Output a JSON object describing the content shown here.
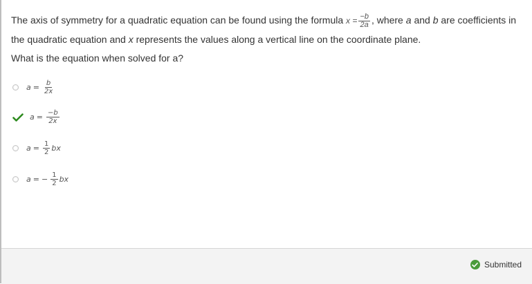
{
  "question": {
    "text_1": "The axis of symmetry for a quadratic equation can be found using the formula",
    "formula_lhs": "x =",
    "formula_num": "−b",
    "formula_den": "2a",
    "text_2": ", where",
    "var_a": "a",
    "text_3": "and",
    "var_b": "b",
    "text_4": "are coefficients in the quadratic equation and",
    "var_x": "x",
    "text_5": "represents the values along a vertical line on the coordinate plane.",
    "prompt": "What is the equation when solved for a?"
  },
  "options": [
    {
      "lhs": "a",
      "eq": "=",
      "sign": "",
      "num": "b",
      "den": "2x",
      "tail": "",
      "state": "unselected"
    },
    {
      "lhs": "a",
      "eq": "=",
      "sign": "",
      "num": "−b",
      "den": "2x",
      "tail": "",
      "state": "correct"
    },
    {
      "lhs": "a",
      "eq": "=",
      "sign": "",
      "num": "1",
      "den": "2",
      "tail": "bx",
      "state": "unselected"
    },
    {
      "lhs": "a",
      "eq": "=",
      "sign": "−",
      "num": "1",
      "den": "2",
      "tail": "bx",
      "state": "unselected"
    }
  ],
  "footer": {
    "status": "Submitted",
    "status_icon": "check-circle-icon",
    "status_color": "#4a9b3b"
  },
  "colors": {
    "check": "#2e8b1f"
  }
}
